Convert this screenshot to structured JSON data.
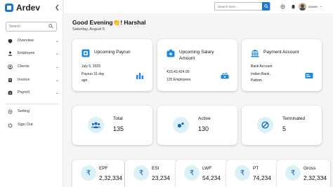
{
  "app": {
    "brand": "Ardev",
    "accent": "#1976d2"
  },
  "sidebar": {
    "search_placeholder": "Search",
    "items": [
      {
        "label": "Overview",
        "icon": "shield-icon"
      },
      {
        "label": "Employee",
        "icon": "user-icon"
      },
      {
        "label": "Clients",
        "icon": "user-circle-icon"
      },
      {
        "label": "Invoice",
        "icon": "invoice-icon"
      },
      {
        "label": "Payroll",
        "icon": "payroll-icon"
      },
      {
        "label": "Setting",
        "icon": "gear-icon"
      },
      {
        "label": "Sign Out",
        "icon": "power-icon"
      }
    ]
  },
  "header": {
    "search_placeholder": "Search here...",
    "user_role": "ADMIN"
  },
  "greeting": {
    "text": "Good Evening👏! Harshal",
    "date": "Saturday, August 5"
  },
  "info_cards": [
    {
      "title": "Upcoming Payrun",
      "line1": "July 5, 2023",
      "line2": "Payrun 31 day",
      "line3": "ago"
    },
    {
      "title": "Upcoming Salary Amount",
      "line1": "₹23,43,424.00",
      "line2": "125 Employees"
    },
    {
      "title": "Payment Account",
      "line1": "Bank Account",
      "line2": "Indian Bank,",
      "line3": "Pattom"
    }
  ],
  "employee_stats": [
    {
      "label": "Total",
      "value": "135",
      "icon": "group-icon"
    },
    {
      "label": "Active",
      "value": "130",
      "icon": "dots-icon"
    },
    {
      "label": "Terminated",
      "value": "5",
      "icon": "block-icon"
    }
  ],
  "deductions": [
    {
      "label": "EPF",
      "value": "2,32,334"
    },
    {
      "label": "ESI",
      "value": "23,234"
    },
    {
      "label": "LWF",
      "value": "54,234"
    },
    {
      "label": "PT",
      "value": "74,234"
    },
    {
      "label": "Gross",
      "value": "2,32,334"
    }
  ]
}
